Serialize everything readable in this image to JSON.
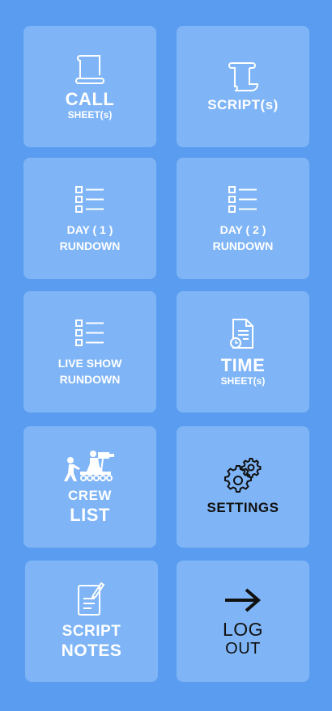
{
  "tiles": {
    "call_sheets": {
      "line1": "CALL",
      "line2": "SHEET(s)",
      "icon": "scroll-icon"
    },
    "scripts": {
      "label": "SCRIPT(s)",
      "icon": "scroll-icon"
    },
    "day1": {
      "line1": "DAY ( 1 )",
      "line2": "RUNDOWN",
      "icon": "checklist-icon"
    },
    "day2": {
      "line1": "DAY ( 2 )",
      "line2": "RUNDOWN",
      "icon": "checklist-icon"
    },
    "live_show": {
      "line1": "LIVE SHOW",
      "line2": "RUNDOWN",
      "icon": "checklist-icon"
    },
    "time_sheets": {
      "line1": "TIME",
      "line2": "SHEET(s)",
      "icon": "timesheet-icon"
    },
    "crew_list": {
      "line1": "CREW",
      "line2": "LIST",
      "icon": "film-crew-icon"
    },
    "settings": {
      "label": "SETTINGS",
      "icon": "gears-icon"
    },
    "script_notes": {
      "line1": "SCRIPT",
      "line2": "NOTES",
      "icon": "notes-icon"
    },
    "logout": {
      "line1": "LOG",
      "line2": "OUT",
      "icon": "arrow-right-icon"
    }
  },
  "colors": {
    "background": "#5a9cef",
    "tile": "#7fb5f6",
    "text_light": "#ffffff",
    "text_dark": "#111111"
  }
}
